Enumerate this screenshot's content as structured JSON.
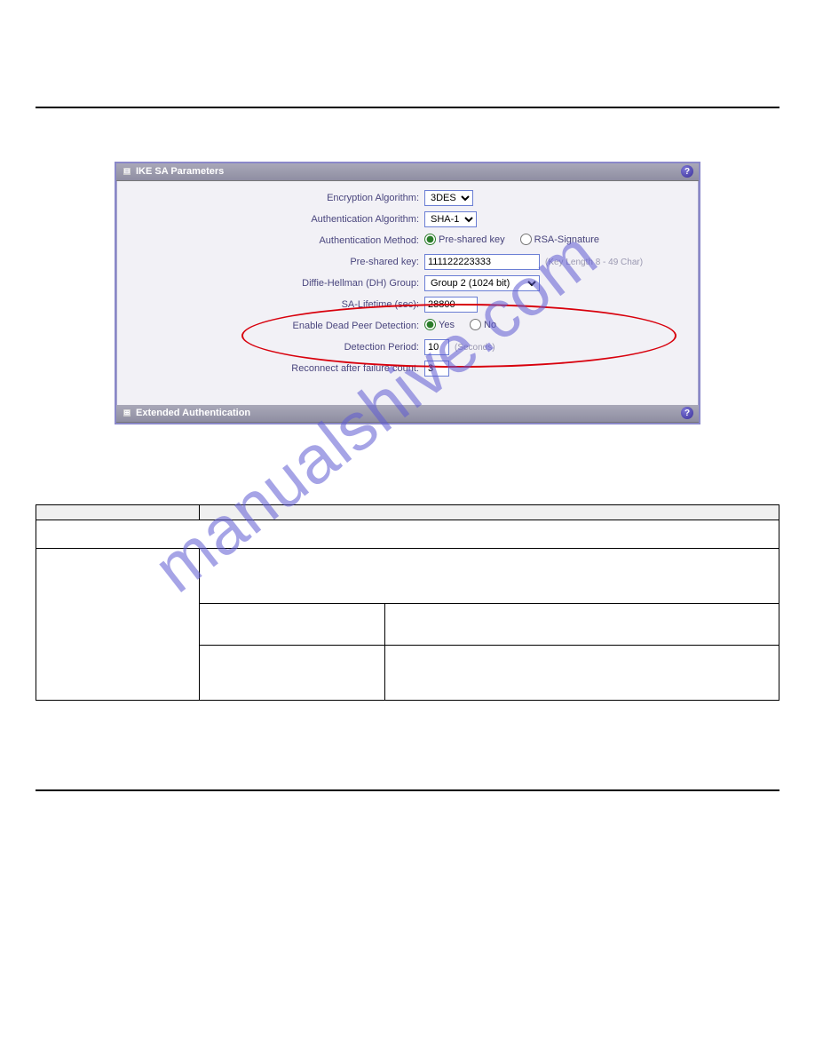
{
  "watermark": "manualshive.com",
  "panel": {
    "section1_title": "IKE SA Parameters",
    "section2_title": "Extended Authentication",
    "fields": {
      "encryption_label": "Encryption Algorithm:",
      "encryption_value": "3DES",
      "auth_alg_label": "Authentication Algorithm:",
      "auth_alg_value": "SHA-1",
      "auth_method_label": "Authentication Method:",
      "auth_method_opt1": "Pre-shared key",
      "auth_method_opt2": "RSA-Signature",
      "presh_label": "Pre-shared key:",
      "presh_value": "111122223333",
      "presh_hint": "(Key Length 8 - 49 Char)",
      "dh_label": "Diffie-Hellman (DH) Group:",
      "dh_value": "Group 2 (1024 bit)",
      "sa_life_label": "SA-Lifetime (sec):",
      "sa_life_value": "28800",
      "dpd_label": "Enable Dead Peer Detection:",
      "dpd_yes": "Yes",
      "dpd_no": "No",
      "detect_label": "Detection Period:",
      "detect_value": "10",
      "detect_hint": "(Seconds)",
      "reconnect_label": "Reconnect after failure count:",
      "reconnect_value": "3"
    }
  },
  "table": {
    "header_col1": "",
    "header_col2": "",
    "row1_cell": "",
    "row2_col1": "",
    "row2_sub1_col2": "",
    "row2_sub1_col3": "",
    "row2_sub2_col2": "",
    "row2_sub2_col3": ""
  }
}
